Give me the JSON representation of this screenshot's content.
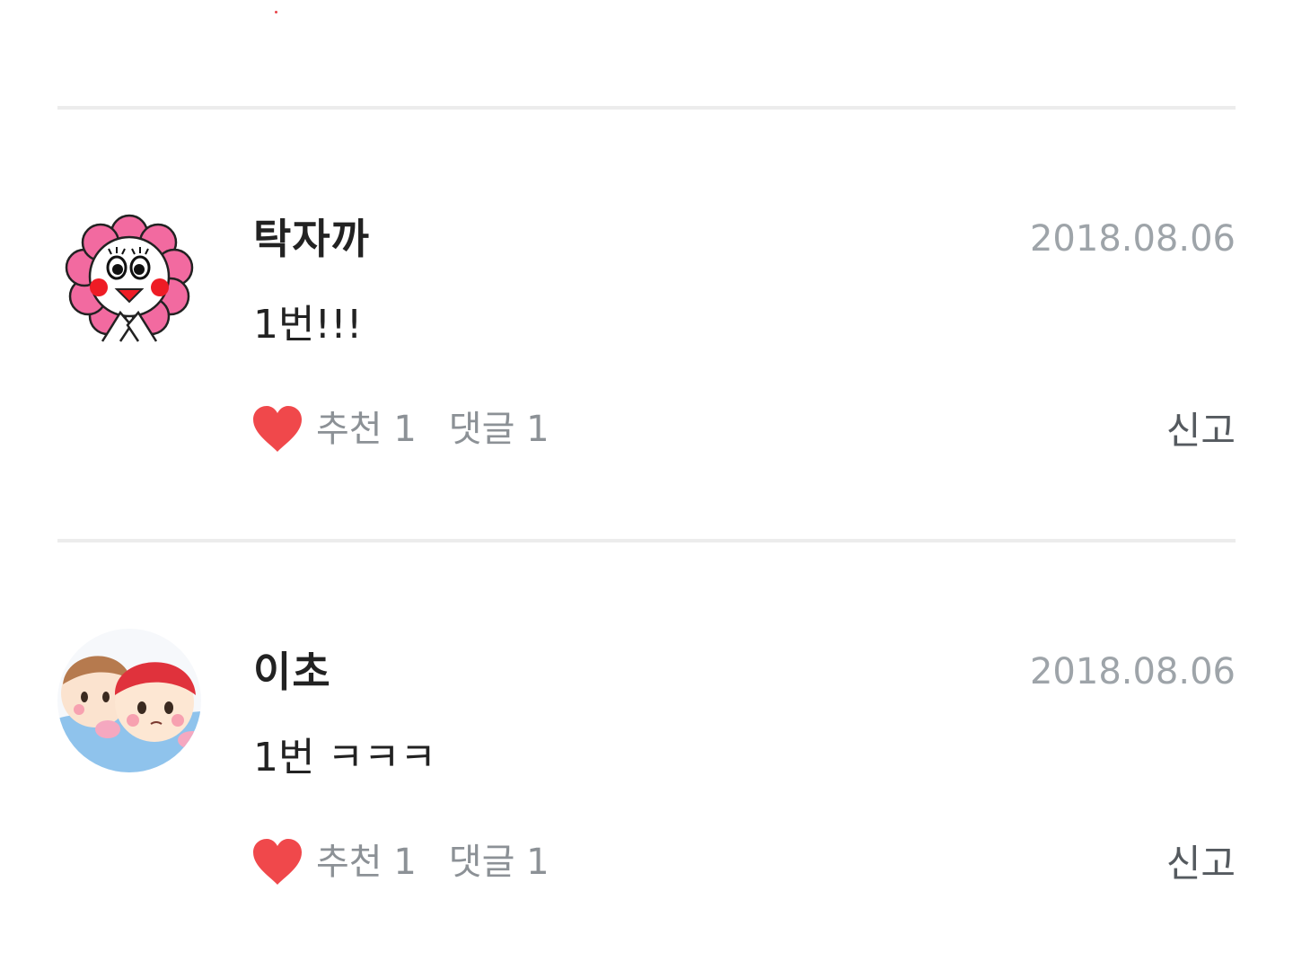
{
  "comments": [
    {
      "author": "탁자까",
      "date": "2018.08.06",
      "text": "1번!!!",
      "recommend_label": "추천 1",
      "reply_label": "댓글 1",
      "report_label": "신고",
      "avatar_icon": "flower-character-avatar"
    },
    {
      "author": "이초",
      "date": "2018.08.06",
      "text": "1번 ㅋㅋㅋ",
      "recommend_label": "추천 1",
      "reply_label": "댓글 1",
      "report_label": "신고",
      "avatar_icon": "two-boys-cartoon-avatar"
    }
  ],
  "colors": {
    "heart": "#f0484b",
    "date": "#9ea4a9",
    "action": "#8c9196",
    "divider": "#ececec"
  }
}
